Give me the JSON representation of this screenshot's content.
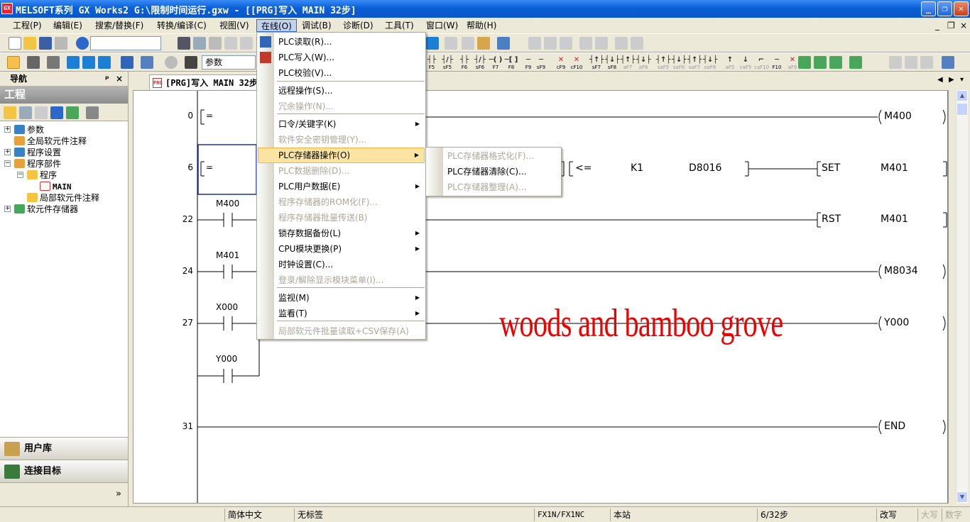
{
  "window": {
    "title": "MELSOFT系列 GX Works2 G:\\限制时间运行.gxw - [[PRG]写入 MAIN 32步]",
    "minimize": "_",
    "restore": "❐",
    "close": "✕"
  },
  "menubar": {
    "items": [
      "工程(P)",
      "编辑(E)",
      "搜索/替换(F)",
      "转换/编译(C)",
      "视图(V)",
      "在线(O)",
      "调试(B)",
      "诊断(D)",
      "工具(T)",
      "窗口(W)",
      "帮助(H)"
    ],
    "active_index": 5,
    "mdi_controls": [
      "_",
      "❐",
      "×"
    ]
  },
  "toolbar2": {
    "param_label": "参数",
    "function_keys": [
      "F5",
      "sF5",
      "F6",
      "sF6",
      "F7",
      "F8",
      "F9",
      "sF9",
      "cF9",
      "cF10",
      "sF7",
      "sF8",
      "aF7",
      "aF8",
      "saF5",
      "saF6",
      "saF7",
      "saF8",
      "aF5",
      "caF5",
      "caF10",
      "F10",
      "aF9"
    ]
  },
  "navigation": {
    "header": "导航",
    "pin": "ᵖ",
    "close": "×",
    "title": "工程",
    "tree": [
      {
        "label": "参数",
        "level": 0,
        "expander": "+"
      },
      {
        "label": "全局软元件注释",
        "level": 0,
        "expander": ""
      },
      {
        "label": "程序设置",
        "level": 0,
        "expander": "+"
      },
      {
        "label": "程序部件",
        "level": 0,
        "expander": "−"
      },
      {
        "label": "程序",
        "level": 1,
        "expander": "−"
      },
      {
        "label": "MAIN",
        "level": 2,
        "expander": ""
      },
      {
        "label": "局部软元件注释",
        "level": 1,
        "expander": ""
      },
      {
        "label": "软元件存储器",
        "level": 0,
        "expander": "+"
      }
    ],
    "sections": [
      "工程",
      "用户库",
      "连接目标"
    ],
    "active_section": 0,
    "more": "»"
  },
  "editor": {
    "tab_title": "[PRG]写入 MAIN 32步",
    "tab_icon": "PRG",
    "rungs": [
      {
        "step": "0",
        "left_text": "=",
        "coil": "M400"
      },
      {
        "step": "6",
        "left_text": "=",
        "compare_op": "<=",
        "operand1": "K1",
        "operand2": "D8016",
        "instr": "SET",
        "target": "M401"
      },
      {
        "step": "22",
        "contact": "M400",
        "instr": "RST",
        "target": "M401"
      },
      {
        "step": "24",
        "contact": "M401",
        "coil": "M8034"
      },
      {
        "step": "27",
        "contact": "X000",
        "parallel": "Y000",
        "coil": "Y000"
      },
      {
        "step": "31",
        "coil": "END"
      }
    ],
    "watermark": "woods and bamboo grove"
  },
  "online_menu": {
    "items": [
      {
        "label": "PLC读取(R)...",
        "disabled": false,
        "submenu": false
      },
      {
        "label": "PLC写入(W)...",
        "disabled": false,
        "submenu": false
      },
      {
        "label": "PLC校验(V)...",
        "disabled": false,
        "submenu": false
      },
      {
        "label": "远程操作(S)...",
        "disabled": false,
        "submenu": false
      },
      {
        "label": "冗余操作(N)...",
        "disabled": true,
        "submenu": false
      },
      {
        "label": "口令/关键字(K)",
        "disabled": false,
        "submenu": true
      },
      {
        "label": "软件安全密钥管理(Y)...",
        "disabled": true,
        "submenu": false
      },
      {
        "label": "PLC存储器操作(O)",
        "disabled": false,
        "submenu": true,
        "highlighted": true
      },
      {
        "label": "PLC数据删除(D)...",
        "disabled": true,
        "submenu": false
      },
      {
        "label": "PLC用户数据(E)",
        "disabled": false,
        "submenu": true
      },
      {
        "label": "程序存储器的ROM化(F)...",
        "disabled": true,
        "submenu": false
      },
      {
        "label": "程序存储器批量传送(B)",
        "disabled": true,
        "submenu": false
      },
      {
        "label": "锁存数据备份(L)",
        "disabled": false,
        "submenu": true
      },
      {
        "label": "CPU模块更换(P)",
        "disabled": false,
        "submenu": true
      },
      {
        "label": "时钟设置(C)...",
        "disabled": false,
        "submenu": false
      },
      {
        "label": "登录/解除显示模块菜单(I)...",
        "disabled": true,
        "submenu": false
      },
      {
        "label": "监视(M)",
        "disabled": false,
        "submenu": true
      },
      {
        "label": "监看(T)",
        "disabled": false,
        "submenu": true
      },
      {
        "label": "局部软元件批量读取+CSV保存(A)",
        "disabled": true,
        "submenu": false
      }
    ]
  },
  "memory_submenu": {
    "items": [
      {
        "label": "PLC存储器格式化(F)...",
        "disabled": true
      },
      {
        "label": "PLC存储器清除(C)...",
        "disabled": false
      },
      {
        "label": "PLC存储器整理(A)...",
        "disabled": true
      }
    ]
  },
  "statusbar": {
    "language": "简体中文",
    "label": "无标签",
    "plc_type": "FX1N/FX1NC",
    "station": "本站",
    "steps": "6/32步",
    "mode": "改写",
    "caps": "大写",
    "num": "数字"
  },
  "colors": {
    "title_blue": "#0a5fd8",
    "menu_hover": "#fbe3a2",
    "watermark_red": "#ee0000",
    "nav_active": "#f6b63c"
  }
}
